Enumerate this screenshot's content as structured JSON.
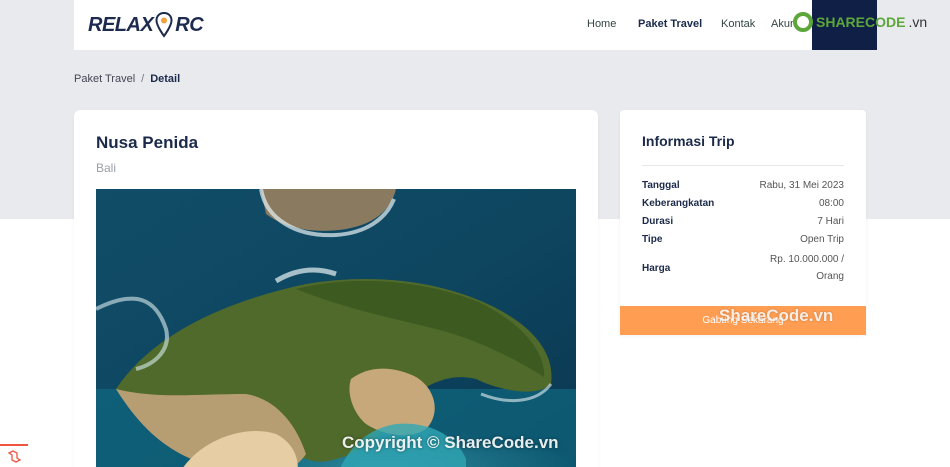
{
  "brand": {
    "name_left": "RELAX",
    "name_right": "RC",
    "logo_icon": "location-pin-icon"
  },
  "nav": {
    "home": "Home",
    "paket": "Paket Travel",
    "kontak": "Kontak",
    "akun": "Akun"
  },
  "sharecode": {
    "part1": "SHARECODE",
    "part2": ".vn"
  },
  "breadcrumb": {
    "parent": "Paket Travel",
    "separator": "/",
    "current": "Detail"
  },
  "trip": {
    "title": "Nusa Penida",
    "location": "Bali"
  },
  "info": {
    "title": "Informasi Trip",
    "rows": [
      {
        "label": "Tanggal",
        "value": "Rabu, 31 Mei 2023"
      },
      {
        "label": "Keberangkatan",
        "value": "08:00"
      },
      {
        "label": "Durasi",
        "value": "7 Hari"
      },
      {
        "label": "Tipe",
        "value": "Open Trip"
      },
      {
        "label": "Harga",
        "value_line1": "Rp. 10.000.000 /",
        "value_line2": "Orang"
      }
    ],
    "join_button": "Gabung Sekarang"
  },
  "watermarks": {
    "side": "ShareCode.vn",
    "bottom": "Copyright © ShareCode.vn"
  },
  "colors": {
    "navy": "#0f1f45",
    "accent_orange": "#ff9e53",
    "page_band": "#e9eaee",
    "sharecode_green": "#5da73a",
    "laravel_red": "#f05340"
  }
}
